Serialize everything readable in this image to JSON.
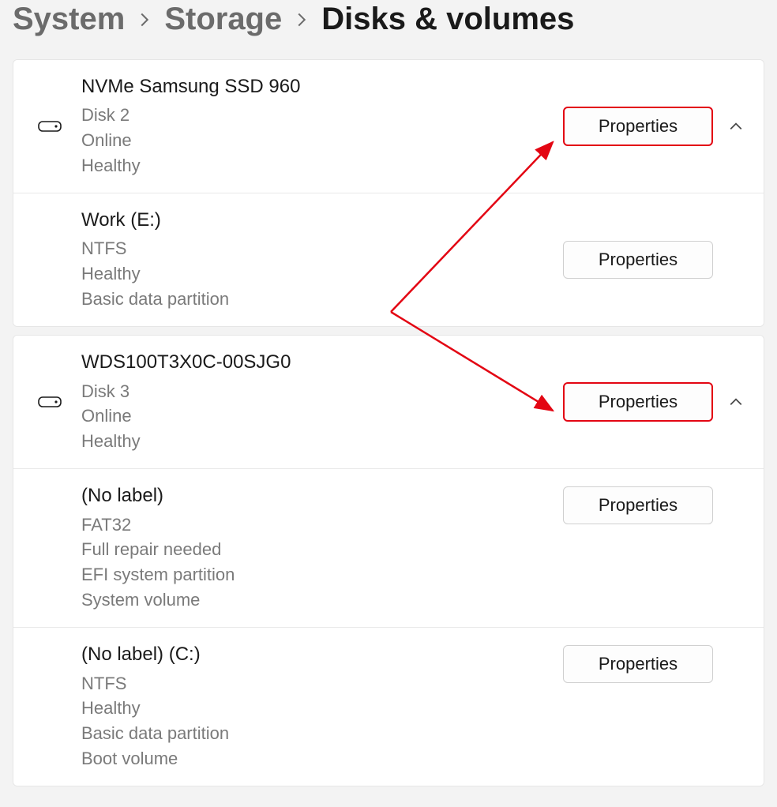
{
  "breadcrumb": {
    "level1": "System",
    "level2": "Storage",
    "level3": "Disks & volumes"
  },
  "buttons": {
    "properties": "Properties"
  },
  "groups": [
    {
      "disk": {
        "name": "NVMe Samsung SSD 960",
        "index_label": "Disk 2",
        "status": "Online",
        "health": "Healthy",
        "highlight": true
      },
      "volumes": [
        {
          "name": "Work (E:)",
          "fs": "NTFS",
          "health": "Healthy",
          "type": "Basic data partition",
          "extra": ""
        }
      ]
    },
    {
      "disk": {
        "name": "WDS100T3X0C-00SJG0",
        "index_label": "Disk 3",
        "status": "Online",
        "health": "Healthy",
        "highlight": true
      },
      "volumes": [
        {
          "name": "(No label)",
          "fs": "FAT32",
          "health": "Full repair needed",
          "type": "EFI system partition",
          "extra": "System volume"
        },
        {
          "name": "(No label) (C:)",
          "fs": "NTFS",
          "health": "Healthy",
          "type": "Basic data partition",
          "extra": "Boot volume"
        }
      ]
    }
  ],
  "annotation": {
    "color": "#e30613"
  }
}
